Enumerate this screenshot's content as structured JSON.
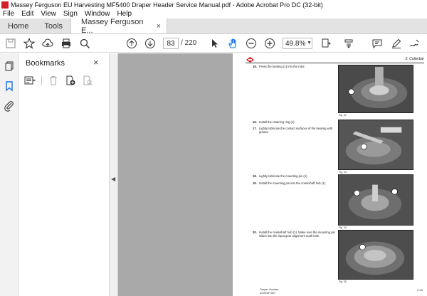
{
  "window": {
    "title": "Massey Ferguson EU Harvesting MF5400 Draper Header Service Manual.pdf - Adobe Acrobat Pro DC (32-bit)"
  },
  "menu": [
    "File",
    "Edit",
    "View",
    "Sign",
    "Window",
    "Help"
  ],
  "tabs": {
    "home": "Home",
    "tools": "Tools",
    "document": "Massey Ferguson E...",
    "close_glyph": "×"
  },
  "toolbar": {
    "page_current": "83",
    "page_total": "/ 220",
    "zoom": "49.8%"
  },
  "bookmarks": {
    "title": "Bookmarks",
    "close_glyph": "×"
  },
  "page": {
    "section": "2. Cutterbar",
    "steps": [
      {
        "num": "15.",
        "text": "Press the bearing (1) into the rotor."
      },
      {
        "num": "16.",
        "text": "Install the retaining ring (1)."
      },
      {
        "num": "17.",
        "text": "Lightly lubricate the contact surfaces of the bearing with grease."
      },
      {
        "num": "18.",
        "text": "Lightly lubricate the mounting pin (1)."
      },
      {
        "num": "19.",
        "text": "Install the mounting pin into the crankshaft hub (1)."
      },
      {
        "num": "20.",
        "text": "Install the crankshaft hub (1). Make sure the mounting pin slides into the input gear alignment mark hole."
      }
    ],
    "figs": [
      "Fig. 32",
      "Fig. 33",
      "Fig. 34",
      "Fig. 35"
    ],
    "footer_left": "Draper Header",
    "footer_code": "4299157057",
    "footer_right": "2-25"
  },
  "colors": {
    "brand_red": "#d4202a",
    "doc_bg": "#a9a9a9",
    "active_blue": "#1a73e8"
  }
}
